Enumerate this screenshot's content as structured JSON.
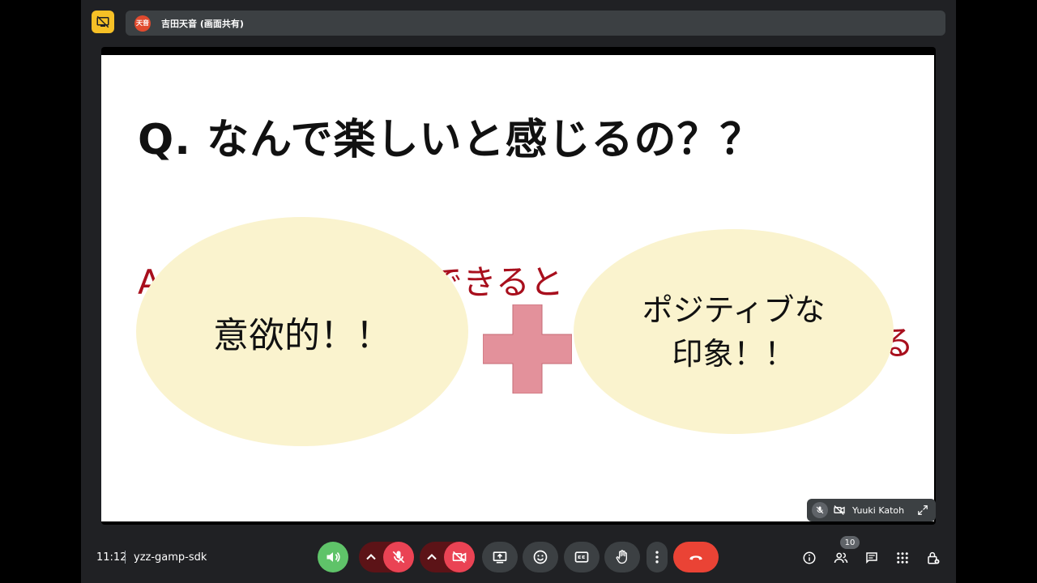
{
  "top_bar": {
    "presenter_avatar_text": "天音",
    "presenter_label": "吉田天音 (画面共有)"
  },
  "slide": {
    "title": "Q. なんで楽しいと感じるの？？",
    "answer_line1": "A",
    "answer_line1_tail": "できると",
    "answer_line2_tail": "る",
    "left_ellipse_text": "意欲的！！",
    "right_ellipse_line1": "ポジティブな",
    "right_ellipse_line2": "印象！！",
    "colors": {
      "title": "#111111",
      "answer": "#a80f1d",
      "ellipse": "#faf3ce",
      "plus": "#e3919b"
    }
  },
  "self_view": {
    "name": "Yuuki Katoh"
  },
  "bottom_bar": {
    "time": "11:12",
    "meeting_code": "yzz-gamp-sdk",
    "people_count": "10",
    "colors": {
      "audio": "#5fc369",
      "muted": "#ea4354",
      "leave": "#ea4335"
    }
  },
  "icons": [
    "present-off-icon",
    "speaker-icon",
    "caret-up-icon",
    "mic-off-icon",
    "cam-off-icon",
    "present-screen-icon",
    "emoji-icon",
    "captions-icon",
    "raise-hand-icon",
    "more-vert-icon",
    "call-end-icon",
    "info-icon",
    "people-icon",
    "chat-icon",
    "apps-icon",
    "host-controls-icon",
    "expand-icon"
  ]
}
